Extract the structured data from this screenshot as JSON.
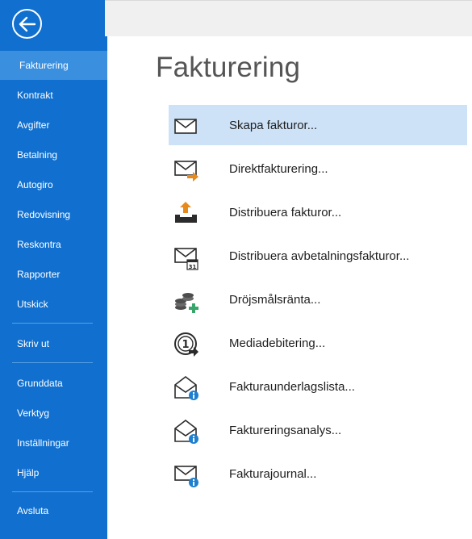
{
  "sidebar": {
    "items": [
      {
        "label": "Fakturering"
      },
      {
        "label": "Kontrakt"
      },
      {
        "label": "Avgifter"
      },
      {
        "label": "Betalning"
      },
      {
        "label": "Autogiro"
      },
      {
        "label": "Redovisning"
      },
      {
        "label": "Reskontra"
      },
      {
        "label": "Rapporter"
      },
      {
        "label": "Utskick"
      },
      {
        "label": "Skriv ut"
      },
      {
        "label": "Grunddata"
      },
      {
        "label": "Verktyg"
      },
      {
        "label": "Inställningar"
      },
      {
        "label": "Hjälp"
      },
      {
        "label": "Avsluta"
      }
    ]
  },
  "main": {
    "title": "Fakturering",
    "commands": [
      {
        "label": "Skapa fakturor...",
        "icon": "envelope-icon"
      },
      {
        "label": "Direktfakturering...",
        "icon": "envelope-arrow-icon"
      },
      {
        "label": "Distribuera fakturor...",
        "icon": "tray-upload-icon"
      },
      {
        "label": "Distribuera avbetalningsfakturor...",
        "icon": "envelope-calendar-icon"
      },
      {
        "label": "Dröjsmålsränta...",
        "icon": "coins-plus-icon"
      },
      {
        "label": "Mediadebitering...",
        "icon": "media-debit-icon"
      },
      {
        "label": "Fakturaunderlagslista...",
        "icon": "open-envelope-info-icon"
      },
      {
        "label": "Faktureringsanalys...",
        "icon": "open-envelope-info-icon"
      },
      {
        "label": "Fakturajournal...",
        "icon": "envelope-info-icon"
      }
    ]
  },
  "colors": {
    "sidebar": "#1170cf",
    "sidebar_active": "#3a8fdf",
    "selected_row": "#cde2f7",
    "accent_orange": "#e8891c",
    "accent_blue": "#1e7fd0",
    "accent_green": "#3aa56a"
  }
}
